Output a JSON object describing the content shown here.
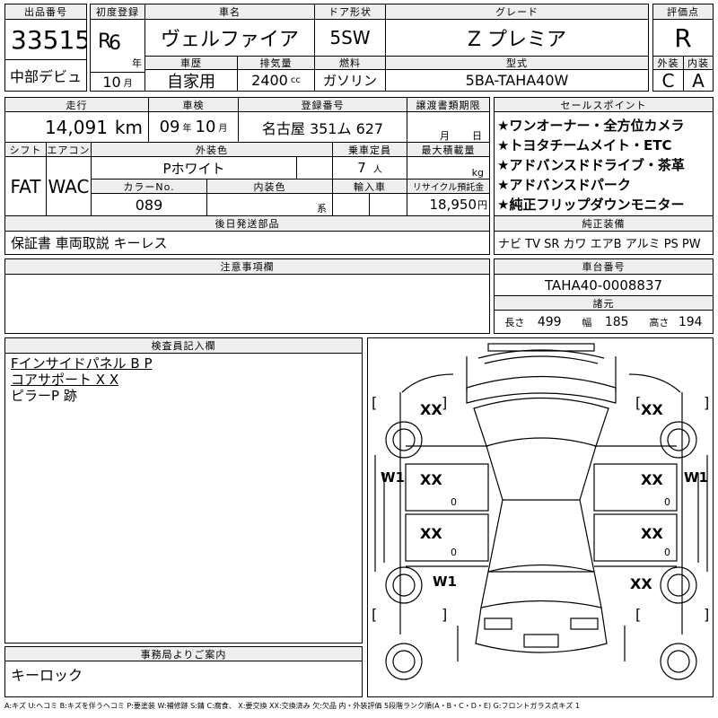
{
  "header": {
    "lot_no_label": "出品番号",
    "lot_no": "33515",
    "debut": "中部デビュ",
    "first_reg_label": "初度登録",
    "era": "R",
    "year": "6",
    "year_unit": "年",
    "month": "10",
    "month_unit": "月",
    "car_name_label": "車名",
    "car_name": "ヴェルファイア",
    "door_label": "ドア形状",
    "door": "5SW",
    "grade_label": "グレード",
    "grade": "Z プレミア",
    "score_label": "評価点",
    "score": "R",
    "history_label": "車歴",
    "history": "自家用",
    "displacement_label": "排気量",
    "displacement": "2400",
    "displacement_unit": "cc",
    "fuel_label": "燃料",
    "fuel": "ガソリン",
    "model_label": "型式",
    "model": "5BA-TAHA40W",
    "exterior_label": "外装",
    "exterior_grade": "C",
    "interior_label": "内装",
    "interior_grade": "A"
  },
  "row2": {
    "mileage_label": "走行",
    "mileage": "14,091",
    "mileage_unit": "km",
    "inspection_label": "車検",
    "inspection_year": "09",
    "inspection_year_unit": "年",
    "inspection_month": "10",
    "inspection_month_unit": "月",
    "plate_label": "登録番号",
    "plate": "名古屋 351ム 627",
    "transfer_label": "譲渡書類期限",
    "transfer_month_unit": "月",
    "transfer_day_unit": "日",
    "shift_label": "シフト",
    "shift": "FAT",
    "ac_label": "エアコン",
    "ac": "WAC",
    "ext_color_label": "外装色",
    "ext_color": "Pホワイト",
    "capacity_label": "乗車定員",
    "capacity": "7",
    "capacity_unit": "人",
    "load_label": "最大積載量",
    "load_unit": "kg",
    "color_no_label": "カラーNo.",
    "color_no": "089",
    "int_color_label": "内装色",
    "int_color_unit": "系",
    "import_label": "輸入車",
    "recycle_label": "リサイクル預託金",
    "recycle": "18,950",
    "recycle_unit": "円"
  },
  "sales_points": {
    "label": "セールスポイント",
    "items": [
      "★ワンオーナー・全方位カメラ",
      "★トヨタチームメイト・ETC",
      "★アドバンスドドライブ・茶革",
      "★アドバンスドパーク",
      "★純正フリップダウンモニター"
    ]
  },
  "later_parts": {
    "label": "後日発送部品",
    "value": "保証書 車両取説 キーレス"
  },
  "equipment": {
    "label": "純正装備",
    "value": "ナビ TV SR カワ エアB アルミ PS PW"
  },
  "notes": {
    "label": "注意事項欄"
  },
  "chassis": {
    "label": "車台番号",
    "value": "TAHA40-0008837"
  },
  "dimensions": {
    "label": "諸元",
    "length_label": "長さ",
    "length": "499",
    "width_label": "幅",
    "width": "185",
    "height_label": "高さ",
    "height": "194"
  },
  "inspector": {
    "label": "検査員記入欄",
    "lines": [
      "Fインサイドパネル B P",
      "コアサポート X X",
      "ピラーP 跡"
    ]
  },
  "office": {
    "label": "事務局よりご案内",
    "value": "キーロック"
  },
  "diagram": {
    "marks": [
      "XX",
      "XX",
      "W1",
      "W1",
      "XX",
      "XX",
      "XX",
      "XX",
      "W1",
      "XX"
    ],
    "zeros": [
      "0",
      "0",
      "0",
      "0"
    ],
    "bracket_open": "[",
    "bracket_close": "]"
  },
  "legend": "A:キズ U:ヘコミ B:キズを伴うヘコミ P:要塗装 W:補修跡 S:錆 C:腐食、 X:要交換 XX:交換済み 欠:欠品 内・外装評価 5段階ランク順(A・B・C・D・E) G:フロントガラス点キズ 1"
}
